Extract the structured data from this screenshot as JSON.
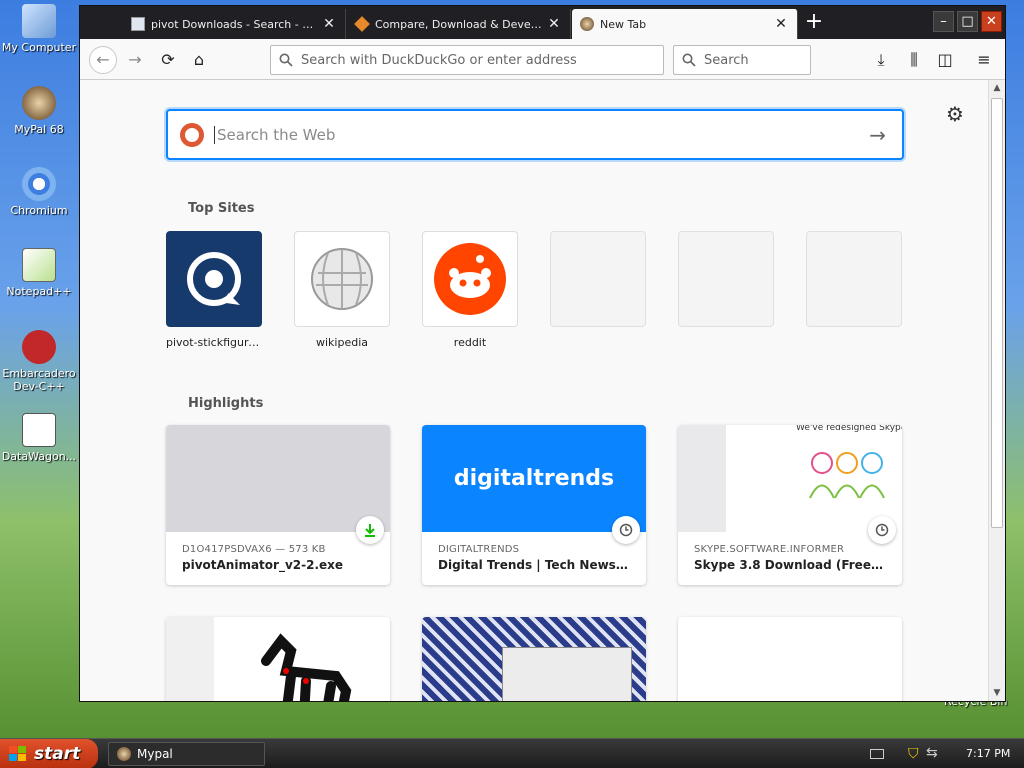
{
  "desktop": {
    "icons": [
      {
        "label": "My Computer"
      },
      {
        "label": "MyPal 68"
      },
      {
        "label": "Chromium"
      },
      {
        "label": "Notepad++"
      },
      {
        "label": "Embarcadero Dev-C++"
      },
      {
        "label": "DataWagon..."
      }
    ],
    "recycle_bin": "Recycle Bin"
  },
  "browser": {
    "tabs": [
      {
        "title": "pivot Downloads - Search - Filepuma"
      },
      {
        "title": "Compare, Download & Develop Open"
      },
      {
        "title": "New Tab",
        "active": true
      }
    ],
    "url_placeholder": "Search with DuckDuckGo or enter address",
    "search_placeholder": "Search",
    "window_controls": {
      "minimize": "–",
      "maximize": "□",
      "close": "✕"
    }
  },
  "newtab": {
    "search_placeholder": "Search the Web",
    "top_sites_title": "Top Sites",
    "top_sites": [
      {
        "label": "pivot-stickfigure-a..."
      },
      {
        "label": "wikipedia"
      },
      {
        "label": "reddit"
      },
      {
        "label": ""
      },
      {
        "label": ""
      },
      {
        "label": ""
      }
    ],
    "highlights_title": "Highlights",
    "highlights": [
      {
        "source": "D1O417PSDVAX6 — 573 KB",
        "title": "pivotAnimator_v2-2.exe",
        "badge": "download-icon"
      },
      {
        "source": "DIGITALTRENDS",
        "title": "Digital Trends | Tech News, Revi...",
        "badge": "clock-icon",
        "thumb_text": "digitaltrends"
      },
      {
        "source": "SKYPE.SOFTWARE.INFORMER",
        "title": "Skype 3.8 Download (Free) - Sky...",
        "badge": "clock-icon",
        "thumb_text": "We've redesigned Skype"
      }
    ]
  },
  "taskbar": {
    "start_label": "start",
    "task_label": "Mypal",
    "clock": "7:17 PM"
  },
  "colors": {
    "accent": "#0a84ff",
    "digitaltrends": "#0a84ff",
    "reddit": "#ff4500",
    "pivot": "#163a6b"
  }
}
